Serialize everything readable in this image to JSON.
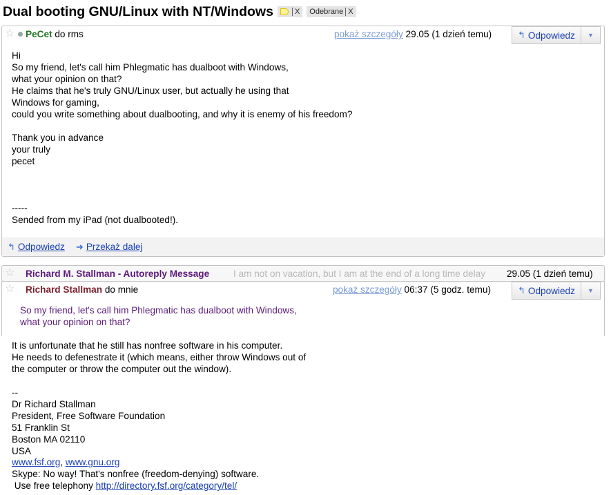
{
  "thread": {
    "subject": "Dual booting GNU/Linux with NT/Windows",
    "labels": [
      {
        "name": "",
        "icon": "label-tag-icon",
        "color": "#fff39a",
        "remove": "X"
      },
      {
        "name": "Odebrane",
        "remove": "X"
      }
    ]
  },
  "message1": {
    "sender": "PeCet",
    "to": "do rms",
    "details_link": "pokaż szczegóły",
    "date": "29.05 (1 dzień temu)",
    "reply_label": "Odpowiedz",
    "body": "Hi\nSo my friend, let's call him Phlegmatic has dualboot with Windows,\nwhat your opinion on that?\nHe claims that he's truly GNU/Linux user, but actually he using that\nWindows for gaming,\ncould you write something about dualbooting, and why it is enemy of his freedom?\n\nThank you in advance\nyour truly\npecet\n\n\n\n-----\nSended from my iPad (not dualbooted!).",
    "footer": {
      "reply": "Odpowiedz",
      "forward": "Przekaż dalej"
    }
  },
  "message2_collapsed": {
    "sender": "Richard M. Stallman - Autoreply Message",
    "snippet": "I am not on vacation, but I am at the end of a long time delay",
    "date": "29.05 (1 dzień temu)"
  },
  "message3": {
    "sender": "Richard Stallman",
    "to": "do mnie",
    "details_link": "pokaż szczegóły",
    "date": "06:37 (5 godz. temu)",
    "reply_label": "Odpowiedz",
    "quoted": "So my friend, let's call him Phlegmatic has dualboot with Windows,\nwhat your opinion on that?",
    "body": "It is unfortunate that he still has nonfree software in his computer.\nHe needs to defenestrate it (which means, either throw Windows out of\nthe computer or throw the computer out the window).\n\n--\nDr Richard Stallman\nPresident, Free Software Foundation\n51 Franklin St\nBoston MA 02110\nUSA",
    "sig_link_fsf": "www.fsf.org",
    "sig_sep": ", ",
    "sig_link_gnu": "www.gnu.org",
    "skype_line": "Skype: No way! That's nonfree (freedom-denying) software.",
    "telephony_prefix": " Use free telephony ",
    "telephony_link": "http://directory.fsf.org/category/tel/"
  }
}
